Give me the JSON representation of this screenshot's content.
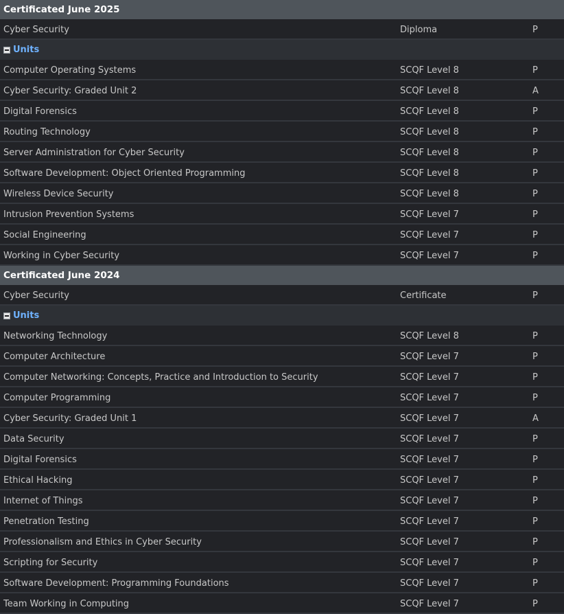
{
  "sections": [
    {
      "title": "Certificated June 2025",
      "award": {
        "name": "Cyber Security",
        "level": "Diploma",
        "result": "P"
      },
      "units_label": "Units",
      "units": [
        {
          "name": "Computer Operating Systems",
          "level": "SCQF Level 8",
          "result": "P"
        },
        {
          "name": "Cyber Security: Graded Unit 2",
          "level": "SCQF Level 8",
          "result": "A"
        },
        {
          "name": "Digital Forensics",
          "level": "SCQF Level 8",
          "result": "P"
        },
        {
          "name": "Routing Technology",
          "level": "SCQF Level 8",
          "result": "P"
        },
        {
          "name": "Server Administration for Cyber Security",
          "level": "SCQF Level 8",
          "result": "P"
        },
        {
          "name": "Software Development: Object Oriented Programming",
          "level": "SCQF Level 8",
          "result": "P"
        },
        {
          "name": "Wireless Device Security",
          "level": "SCQF Level 8",
          "result": "P"
        },
        {
          "name": "Intrusion Prevention Systems",
          "level": "SCQF Level 7",
          "result": "P"
        },
        {
          "name": "Social Engineering",
          "level": "SCQF Level 7",
          "result": "P"
        },
        {
          "name": "Working in Cyber Security",
          "level": "SCQF Level 7",
          "result": "P"
        }
      ]
    },
    {
      "title": "Certificated June 2024",
      "award": {
        "name": "Cyber Security",
        "level": "Certificate",
        "result": "P"
      },
      "units_label": "Units",
      "units": [
        {
          "name": "Networking Technology",
          "level": "SCQF Level 8",
          "result": "P"
        },
        {
          "name": "Computer Architecture",
          "level": "SCQF Level 7",
          "result": "P"
        },
        {
          "name": "Computer Networking: Concepts, Practice and Introduction to Security",
          "level": "SCQF Level 7",
          "result": "P"
        },
        {
          "name": "Computer Programming",
          "level": "SCQF Level 7",
          "result": "P"
        },
        {
          "name": "Cyber Security: Graded Unit 1",
          "level": "SCQF Level 7",
          "result": "A"
        },
        {
          "name": "Data Security",
          "level": "SCQF Level 7",
          "result": "P"
        },
        {
          "name": "Digital Forensics",
          "level": "SCQF Level 7",
          "result": "P"
        },
        {
          "name": "Ethical Hacking",
          "level": "SCQF Level 7",
          "result": "P"
        },
        {
          "name": "Internet of Things",
          "level": "SCQF Level 7",
          "result": "P"
        },
        {
          "name": "Penetration Testing",
          "level": "SCQF Level 7",
          "result": "P"
        },
        {
          "name": "Professionalism and Ethics in Cyber Security",
          "level": "SCQF Level 7",
          "result": "P"
        },
        {
          "name": "Scripting for Security",
          "level": "SCQF Level 7",
          "result": "P"
        },
        {
          "name": "Software Development: Programming Foundations",
          "level": "SCQF Level 7",
          "result": "P"
        },
        {
          "name": "Team Working in Computing",
          "level": "SCQF Level 7",
          "result": "P"
        }
      ]
    }
  ],
  "icons": {
    "collapse": "minus-box-icon"
  },
  "colors": {
    "header_bg": "#4f555b",
    "row_bg": "#222327",
    "units_bg": "#2d3035",
    "units_text": "#6fb2ff",
    "text": "#c8c8c8"
  }
}
